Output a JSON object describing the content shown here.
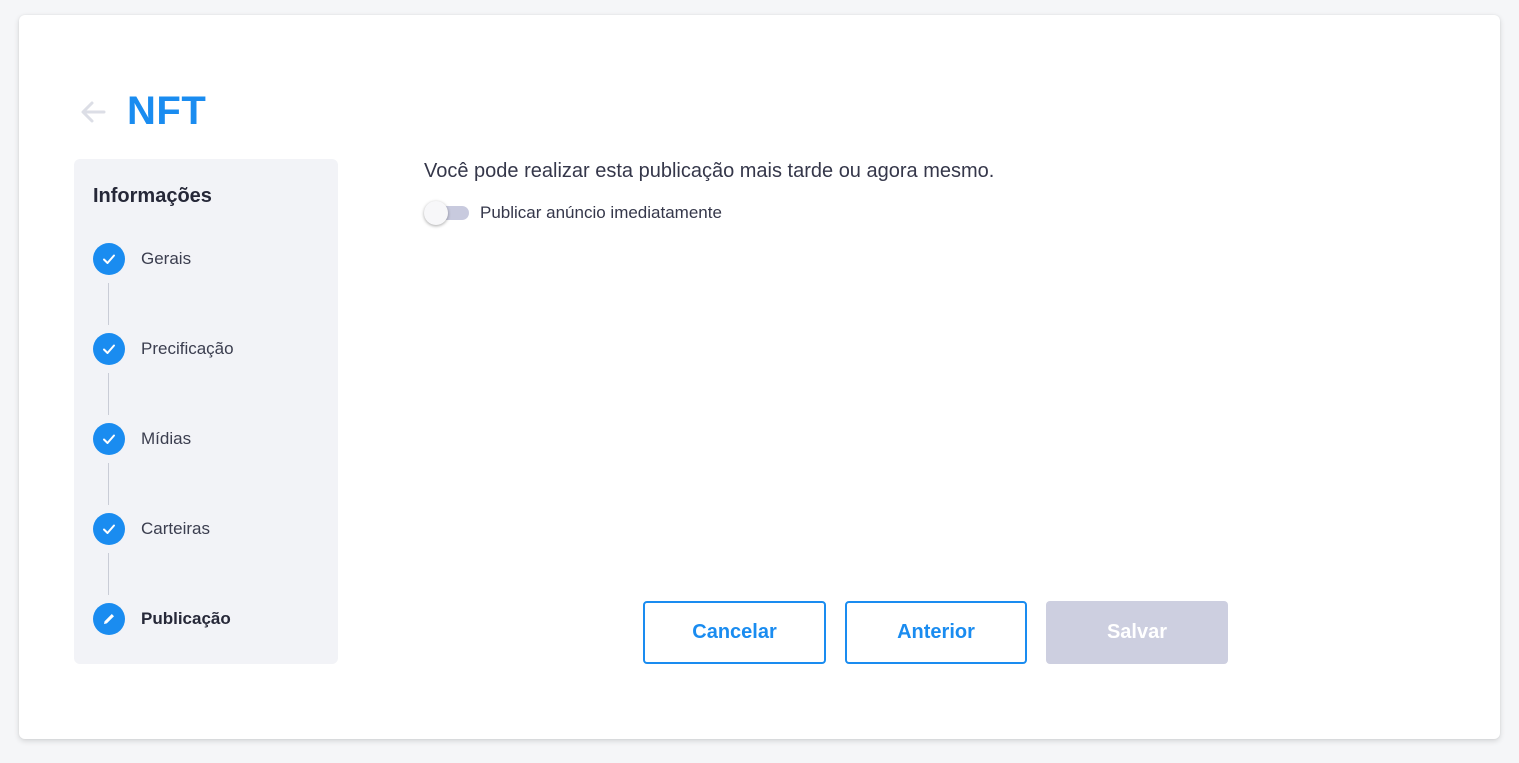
{
  "header": {
    "back_icon": "arrow-left-icon",
    "title": "NFT"
  },
  "steps": {
    "heading": "Informações",
    "items": [
      {
        "label": "Gerais",
        "status": "done",
        "icon": "check-icon"
      },
      {
        "label": "Precificação",
        "status": "done",
        "icon": "check-icon"
      },
      {
        "label": "Mídias",
        "status": "done",
        "icon": "check-icon"
      },
      {
        "label": "Carteiras",
        "status": "done",
        "icon": "check-icon"
      },
      {
        "label": "Publicação",
        "status": "current",
        "icon": "pencil-icon"
      }
    ]
  },
  "main": {
    "instruction": "Você pode realizar esta publicação mais tarde ou agora mesmo.",
    "toggle": {
      "label": "Publicar anúncio imediatamente",
      "checked": false
    }
  },
  "actions": {
    "cancel_label": "Cancelar",
    "previous_label": "Anterior",
    "save_label": "Salvar",
    "save_disabled": true
  },
  "colors": {
    "accent": "#1a8cf0",
    "panel_bg": "#f2f3f7",
    "disabled_bg": "#cdcfe0",
    "toggle_track": "#c8cade"
  }
}
